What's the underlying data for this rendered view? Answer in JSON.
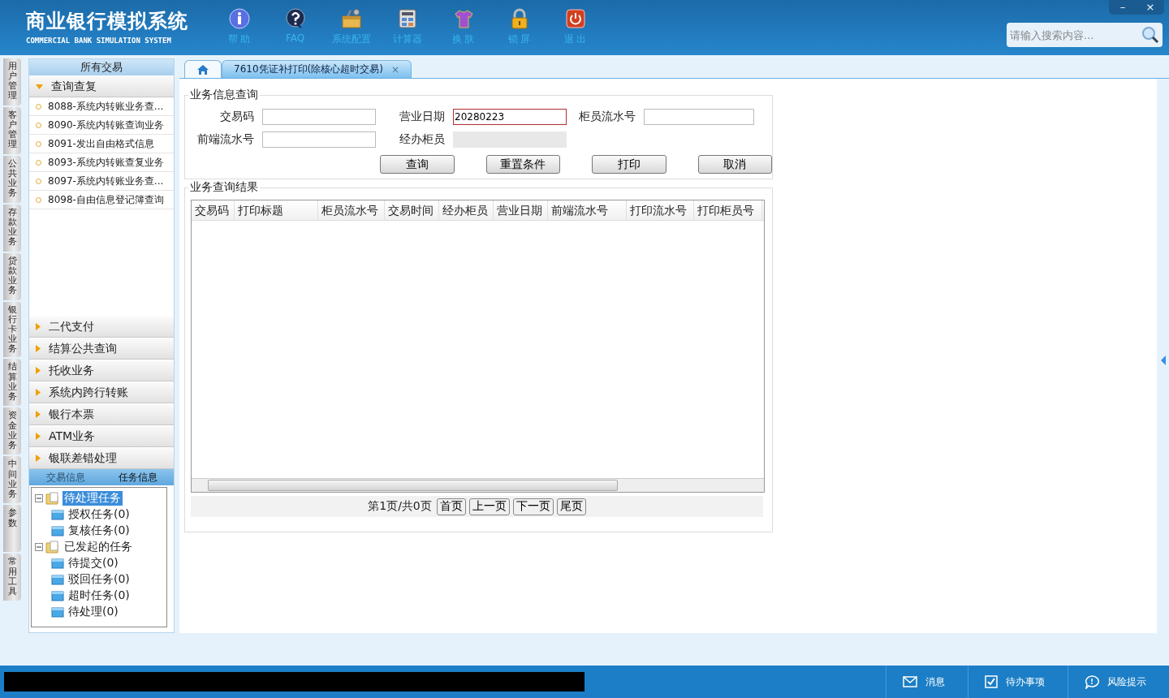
{
  "header": {
    "title": "商业银行模拟系统",
    "subtitle": "COMMERCIAL BANK SIMULATION SYSTEM",
    "window_buttons": [
      "–",
      "×"
    ],
    "toolbar": [
      {
        "kind": "info",
        "label": "帮 助"
      },
      {
        "kind": "faq",
        "label": "FAQ"
      },
      {
        "kind": "toolbox",
        "label": "系统配置"
      },
      {
        "kind": "calculator",
        "label": "计算器"
      },
      {
        "kind": "shirt",
        "label": "换 肤"
      },
      {
        "kind": "lock",
        "label": "锁 屏"
      },
      {
        "kind": "power",
        "label": "退 出"
      }
    ],
    "search": {
      "placeholder": "请输入搜索内容..."
    }
  },
  "side_tabs": [
    "用户管理",
    "客户管理",
    "公共业务",
    "存款业务",
    "贷款业务",
    "银行卡业务",
    "结算业务",
    "资金业务",
    "中间业务",
    "参数",
    "常用工具"
  ],
  "sidebar": {
    "title": "所有交易",
    "groups": [
      {
        "label": "查询查复",
        "expanded": true,
        "items": [
          "8088-系统内转账业务查...",
          "8090-系统内转账查询业务",
          "8091-发出自由格式信息",
          "8093-系统内转账查复业务",
          "8097-系统内转账业务查...",
          "8098-自由信息登记簿查询"
        ]
      },
      {
        "label": "二代支付",
        "expanded": false
      },
      {
        "label": "结算公共查询",
        "expanded": false
      },
      {
        "label": "托收业务",
        "expanded": false
      },
      {
        "label": "系统内跨行转账",
        "expanded": false
      },
      {
        "label": "银行本票",
        "expanded": false
      },
      {
        "label": "ATM业务",
        "expanded": false
      },
      {
        "label": "银联差错处理",
        "expanded": false
      }
    ],
    "panel_tabs": [
      {
        "label": "交易信息",
        "selected": false
      },
      {
        "label": "任务信息",
        "selected": true
      }
    ],
    "tree": [
      {
        "label": "待处理任务",
        "selected": true,
        "expanded": true,
        "children": [
          {
            "label": "授权任务(0)",
            "selected": false
          },
          {
            "label": "复核任务(0)",
            "selected": false
          }
        ]
      },
      {
        "label": "已发起的任务",
        "selected": false,
        "expanded": true,
        "children": [
          {
            "label": "待提交(0)",
            "selected": false
          },
          {
            "label": "驳回任务(0)",
            "selected": false
          },
          {
            "label": "超时任务(0)",
            "selected": false
          },
          {
            "label": "待处理(0)",
            "selected": false
          }
        ]
      }
    ]
  },
  "tabs": [
    {
      "kind": "home",
      "selected": false
    },
    {
      "kind": "page",
      "label": "7610凭证补打印(除核心超时交易)",
      "close": "×",
      "selected": true
    }
  ],
  "query": {
    "title": "业务信息查询",
    "fields": [
      {
        "label": "交易码",
        "focused": false,
        "disabled": false
      },
      {
        "label": "营业日期",
        "value": "20280223",
        "focused": true,
        "disabled": false
      },
      {
        "label": "柜员流水号",
        "focused": false,
        "disabled": false
      },
      {
        "label": "前端流水号",
        "focused": false,
        "disabled": false
      },
      {
        "label": "经办柜员",
        "focused": false,
        "disabled": true
      }
    ],
    "buttons": [
      "查询",
      "重置条件",
      "打印",
      "取消"
    ]
  },
  "results": {
    "title": "业务查询结果",
    "columns": [
      "交易码",
      "打印标题",
      "柜员流水号",
      "交易时间",
      "经办柜员",
      "营业日期",
      "前端流水号",
      "打印流水号",
      "打印柜员号"
    ],
    "pager": {
      "info": "第1页/共0页",
      "buttons": [
        "首页",
        "上一页",
        "下一页",
        "尾页"
      ]
    }
  },
  "status_bar": {
    "items": [
      {
        "kind": "message",
        "label": "消息"
      },
      {
        "kind": "todo",
        "label": "待办事项"
      },
      {
        "kind": "risk",
        "label": "风险提示"
      }
    ]
  }
}
